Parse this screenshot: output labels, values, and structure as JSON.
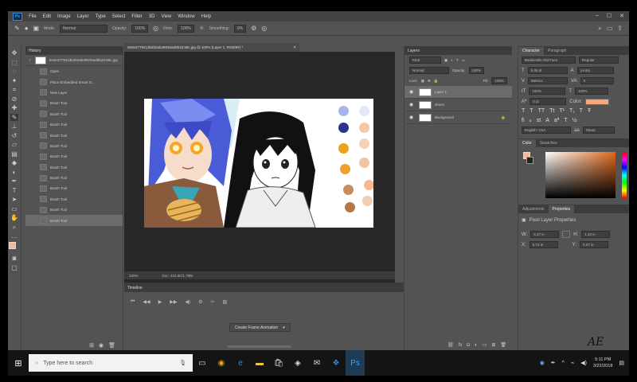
{
  "menubar": {
    "logo": "Ps",
    "items": [
      "File",
      "Edit",
      "Image",
      "Layer",
      "Type",
      "Select",
      "Filter",
      "3D",
      "View",
      "Window",
      "Help"
    ]
  },
  "options": {
    "mode_label": "Mode:",
    "mode_value": "Normal",
    "opacity_label": "Opacity:",
    "opacity_value": "100%",
    "flow_label": "Flow:",
    "flow_value": "100%",
    "smoothing_label": "Smoothing:",
    "smoothing_value": "0%"
  },
  "history": {
    "title": "History",
    "snapshot": "0e0e3779413b4b2ab48045ad8b2d.58c.jpg",
    "items": [
      "Open",
      "Place Embedded Smart O...",
      "New Layer",
      "Brush Tool",
      "Brush Tool",
      "Brush Tool",
      "Brush Tool",
      "Brush Tool",
      "Brush Tool",
      "Brush Tool",
      "Brush Tool",
      "Brush Tool",
      "Brush Tool",
      "Brush Tool",
      "Brush Tool"
    ]
  },
  "document": {
    "tab": "0e0e3779413b4b2ab48045ad8b2d.58c.jpg @ 100% (Layer 1, RGB/8#) *",
    "zoom": "100%",
    "doc_size": "Doc: 422.6K/1.79M"
  },
  "timeline": {
    "title": "Timeline",
    "create_button": "Create Frame Animation"
  },
  "layers": {
    "title": "Layers",
    "kind": "Kind",
    "blend": "Normal",
    "opacity_label": "Opacity:",
    "opacity_value": "100%",
    "lock_label": "Lock:",
    "fill_label": "Fill:",
    "fill_value": "100%",
    "items": [
      {
        "name": "Layer 1",
        "selected": true
      },
      {
        "name": "shoes",
        "selected": false
      },
      {
        "name": "Background",
        "selected": false
      }
    ]
  },
  "character": {
    "tabs": [
      "Character",
      "Paragraph"
    ],
    "font": "Baskerville Old Face",
    "style": "Regular",
    "size": "5.35 pt",
    "leading": "(Auto)",
    "kerning": "Metrics",
    "tracking": "0",
    "vscale": "100%",
    "hscale": "100%",
    "baseline": "0 pt",
    "color_label": "Color:",
    "language": "English: USA",
    "aa": "Sharp"
  },
  "color_panel": {
    "tabs": [
      "Color",
      "Swatches"
    ]
  },
  "properties": {
    "tabs": [
      "Adjustments",
      "Properties"
    ],
    "heading": "Pixel Layer Properties",
    "w_label": "W:",
    "w_value": "5.27 in",
    "h_label": "H:",
    "h_value": "1.34 in",
    "x_label": "X:",
    "x_value": "5.74 in",
    "y_label": "Y:",
    "y_value": "0.07 in"
  },
  "taskbar": {
    "search_placeholder": "Type here to search",
    "time": "5:11 PM",
    "date": "3/22/2018"
  },
  "watermark": "AE",
  "colors": {
    "accent": "#31a8ff",
    "foreground_swatch": "#f4b995",
    "character_color": "#f7a67a",
    "picker_hue": "#e06a1a"
  }
}
